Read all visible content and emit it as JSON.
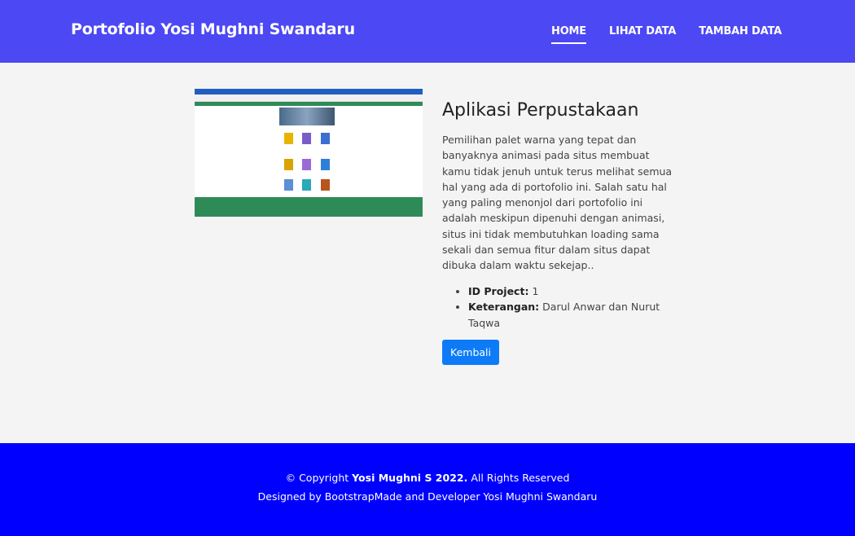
{
  "header": {
    "brand": "Portofolio Yosi Mughni Swandaru",
    "nav": [
      {
        "label": "HOME",
        "active": true
      },
      {
        "label": "LIHAT DATA",
        "active": false
      },
      {
        "label": "TAMBAH DATA",
        "active": false
      }
    ]
  },
  "project": {
    "title": "Aplikasi Perpustakaan",
    "description": "Pemilihan palet warna yang tepat dan banyaknya animasi pada situs membuat kamu tidak jenuh untuk terus melihat semua hal yang ada di portofolio ini. Salah satu hal yang paling menonjol dari portofolio ini adalah meskipun dipenuhi dengan animasi, situs ini tidak membutuhkan loading sama sekali dan semua fitur dalam situs dapat dibuka dalam waktu sekejap..",
    "details": [
      {
        "label": "ID Project:",
        "value": "1"
      },
      {
        "label": "Keterangan:",
        "value": "Darul Anwar dan Nurut Taqwa"
      }
    ],
    "back_label": "Kembali"
  },
  "footer": {
    "copyright_prefix": "© Copyright",
    "copyright_name": "Yosi Mughni S 2022.",
    "copyright_suffix": "All Rights Reserved",
    "credit": "Designed by BootstrapMade and Developer Yosi Mughni Swandaru"
  },
  "colors": {
    "navbar": "#4c48f4",
    "footer": "#0000ff",
    "button": "#0d7bf7",
    "background": "#f4f4f4"
  }
}
